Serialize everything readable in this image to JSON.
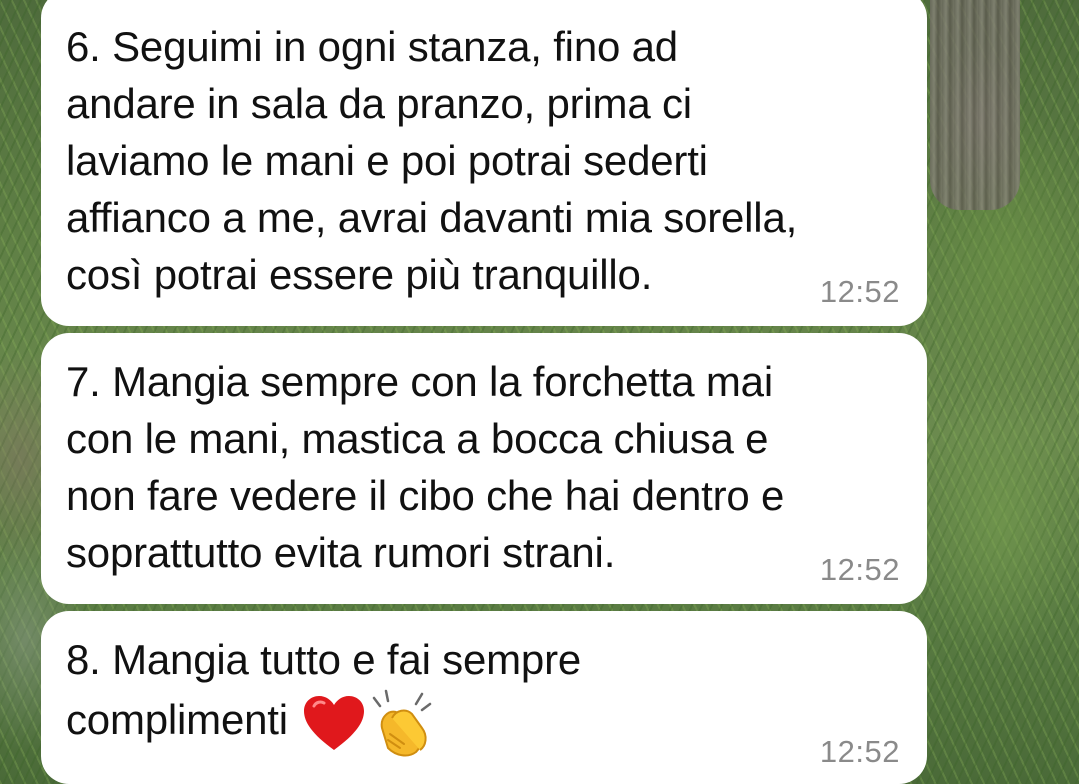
{
  "messages": [
    {
      "text": "6. Seguimi in ogni stanza, fino ad\nandare in sala da pranzo, prima ci\nlaviamo le mani e poi potrai sederti\naffianco a me, avrai davanti mia sorella,\ncosì potrai essere più tranquillo.",
      "time": "12:52"
    },
    {
      "text": "7. Mangia sempre con la forchetta mai\ncon le mani, mastica a bocca chiusa e\nnon fare vedere il cibo che hai dentro e\nsoprattutto evita rumori strani.",
      "time": "12:52"
    },
    {
      "text": "8. Mangia tutto e fai sempre\ncomplimenti",
      "emojis": [
        "red-heart-icon",
        "clapping-hands-icon"
      ],
      "time": "12:52"
    }
  ],
  "colors": {
    "bubble": "#ffffff",
    "text": "#111111",
    "timestamp": "#8a8a8a"
  }
}
